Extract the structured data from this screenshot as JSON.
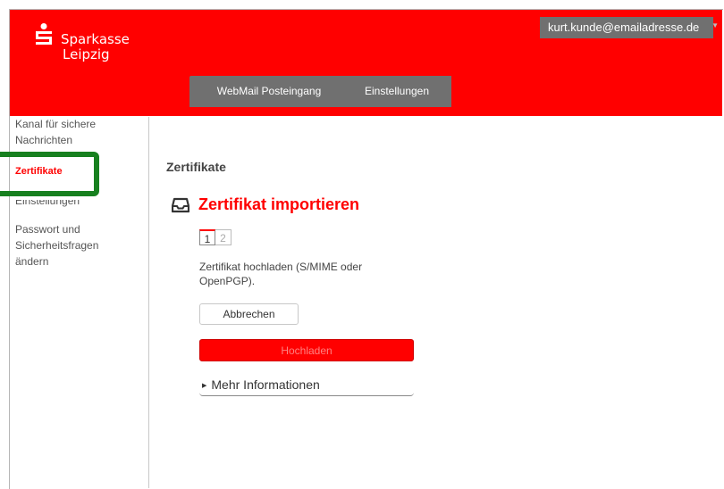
{
  "header": {
    "brand_line1": "Sparkasse",
    "brand_line2": "Leipzig",
    "user_email": "kurt.kunde@emailadresse.de",
    "tabs": [
      {
        "label": "WebMail Posteingang"
      },
      {
        "label": "Einstellungen"
      }
    ],
    "brand_color": "#ff0000"
  },
  "sidebar": {
    "items": [
      {
        "label_line1": "Kanal für sichere",
        "label_line2": "Nachrichten"
      },
      {
        "label": "Zertifikate",
        "active": true
      },
      {
        "label": "Einstellungen"
      },
      {
        "label_line1": "Passwort und",
        "label_line2": "Sicherheitsfragen",
        "label_line3": "ändern"
      }
    ],
    "highlight_color": "#17801f"
  },
  "main": {
    "section_title": "Zertifikate",
    "import_title": "Zertifikat importieren",
    "steps": [
      "1",
      "2"
    ],
    "description": "Zertifikat hochladen (S/MIME oder OpenPGP).",
    "cancel_label": "Abbrechen",
    "upload_label": "Hochladen",
    "more_info_label": "Mehr Informationen"
  }
}
